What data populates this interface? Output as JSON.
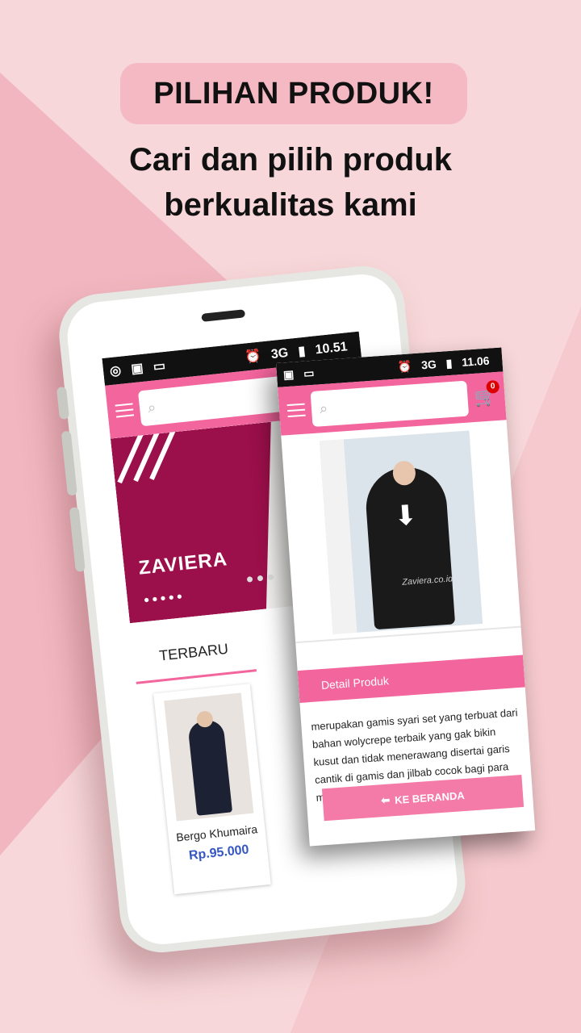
{
  "headline": "PILIHAN PRODUK!",
  "subtitle": [
    "Cari dan pilih produk",
    "berkualitas kami"
  ],
  "back_screen": {
    "status_time": "10.51",
    "network": "3G",
    "banner_brand": "ZAVIERA",
    "tab_label": "TERBARU",
    "product": {
      "name": "Bergo Khumaira",
      "price": "Rp.95.000"
    }
  },
  "front_screen": {
    "status_time": "11.06",
    "network": "3G",
    "cart_count": "0",
    "watermark": "Zaviera.co.id",
    "detail_header": "Detail Produk",
    "description": "merupakan gamis syari set yang terbuat dari bahan wolycrepe terbaik yang gak bikin kusut dan tidak menerawang disertai garis cantik di gamis dan jilbab cocok bagi para muslimah",
    "back_button": "KE BERANDA"
  },
  "colors": {
    "accent": "#f3659d",
    "price": "#3656c5",
    "banner": "#9b0f4a"
  }
}
